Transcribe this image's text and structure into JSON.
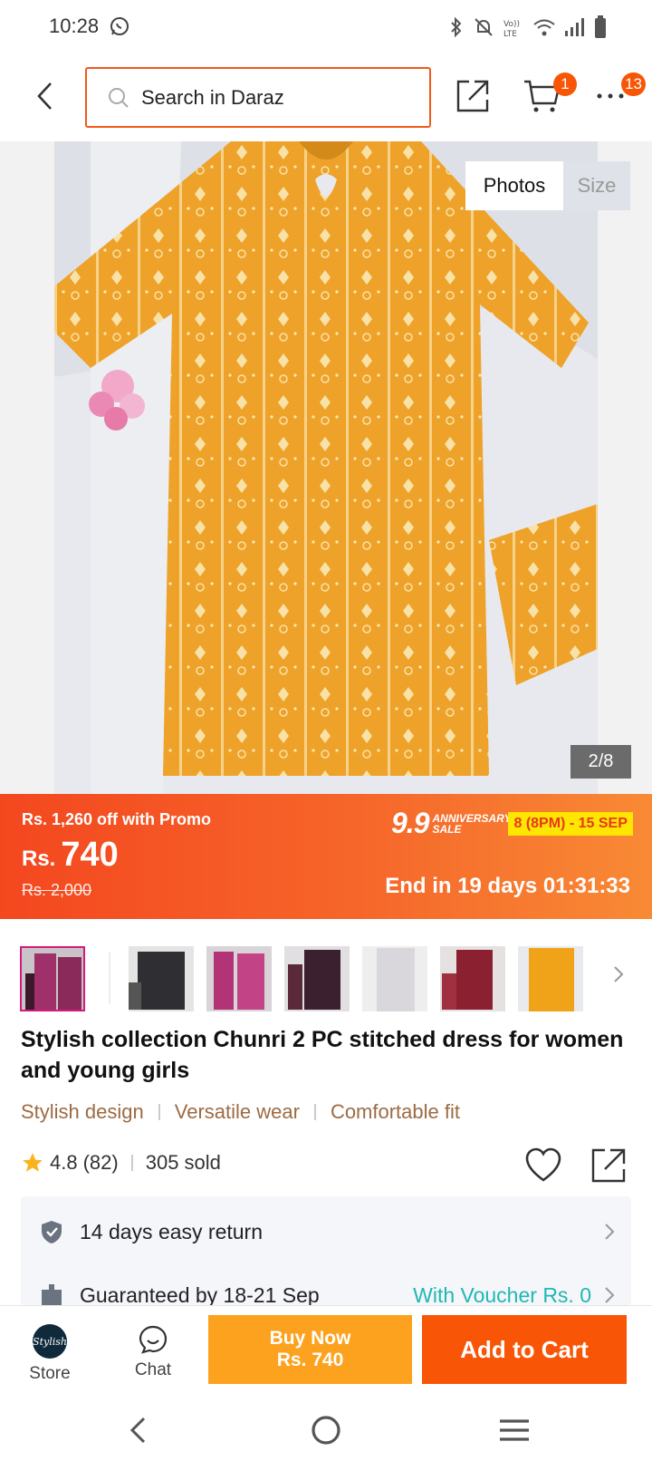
{
  "status_bar": {
    "time": "10:28",
    "whatsapp_icon": "whatsapp-icon",
    "icons": [
      "bluetooth-icon",
      "mute-icon",
      "volte-icon",
      "wifi-icon",
      "signal-icon",
      "battery-icon"
    ]
  },
  "top_nav": {
    "search_placeholder": "Search in Daraz",
    "cart_badge": "1",
    "more_badge": "13"
  },
  "gallery": {
    "tab_photos": "Photos",
    "tab_size": "Size",
    "counter": "2/8"
  },
  "promo": {
    "off_text": "Rs. 1,260 off with Promo",
    "currency": "Rs.",
    "price": "740",
    "original_price": "Rs. 2,000",
    "event_big": "9.9",
    "event_small_1": "ANNIVERSARY",
    "event_small_2": "SALE",
    "event_dates": "8 (8PM) - 15 SEP",
    "ends_in": "End in 19 days 01:31:33",
    "colors": {
      "start": "#f4471f",
      "end": "#f88a35",
      "date_bg": "#ffe600"
    }
  },
  "thumbnails": [
    {
      "color": "#a0306a",
      "accent": "#3a1a2a"
    },
    {
      "color": "#2f2f33",
      "accent": "#8a8a8a"
    },
    {
      "color": "#b23476",
      "accent": "#f0b0d0"
    },
    {
      "color": "#3b2030",
      "accent": "#b02050"
    },
    {
      "color": "#d9d6dc",
      "accent": "#8a8a9a"
    },
    {
      "color": "#8a2030",
      "accent": "#d05060"
    },
    {
      "color": "#f0a218",
      "accent": "#ffe7a8"
    }
  ],
  "product": {
    "title": "Stylish collection Chunri 2 PC stitched dress for women and young girls",
    "tags": [
      "Stylish design",
      "Versatile wear",
      "Comfortable fit"
    ],
    "rating": "4.8",
    "reviews": "(82)",
    "sold": "305 sold"
  },
  "service": {
    "return_text": "14 days easy return",
    "delivery_text": "Guaranteed by 18-21 Sep",
    "voucher_text": "With Voucher Rs. 0"
  },
  "actions": {
    "store_label": "Store",
    "store_logo_text": "Stylish",
    "chat_label": "Chat",
    "buy_now_line1": "Buy Now",
    "buy_now_line2": "Rs. 740",
    "add_to_cart": "Add to Cart"
  }
}
